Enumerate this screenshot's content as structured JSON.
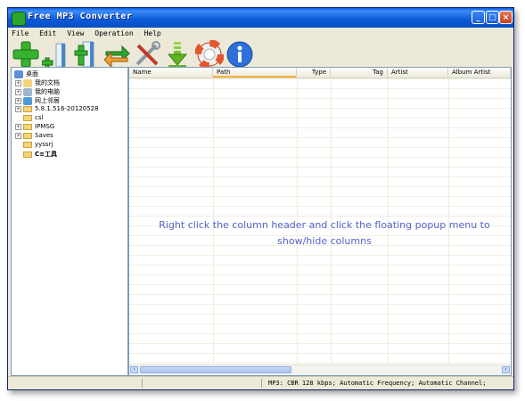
{
  "window": {
    "title": "Free MP3 Converter",
    "controls": {
      "minimize": "_",
      "maximize": "□",
      "close": "×"
    }
  },
  "menu": [
    "File",
    "Edit",
    "View",
    "Operation",
    "Help"
  ],
  "toolbar": {
    "buttons": [
      {
        "name": "add-files-icon",
        "color": "#2ea52b"
      },
      {
        "name": "add-folder-icon",
        "color": "#2ea52b"
      },
      {
        "name": "remove-file-icon",
        "color": "#2ea52b"
      },
      {
        "name": "convert-icon",
        "color": "#2e9d2e"
      },
      {
        "name": "tools-icon",
        "color": "#6f7f8f"
      },
      {
        "name": "download-icon",
        "color": "#8ad13b"
      },
      {
        "name": "help-lifebuoy-icon",
        "color": "#e4572e"
      },
      {
        "name": "about-info-icon",
        "color": "#2f6fd8"
      }
    ]
  },
  "tree": {
    "items": [
      {
        "label": "桌面",
        "expander": "",
        "icon": "desktop-icon"
      },
      {
        "label": "我的文档",
        "expander": "+",
        "icon": "documents-icon"
      },
      {
        "label": "我的电脑",
        "expander": "+",
        "icon": "computer-icon"
      },
      {
        "label": "网上邻居",
        "expander": "+",
        "icon": "network-icon"
      },
      {
        "label": "5.8.1.516-20120528",
        "expander": "+",
        "icon": "folder-icon"
      },
      {
        "label": "csl",
        "expander": "",
        "icon": "folder-icon"
      },
      {
        "label": "IPMSG",
        "expander": "+",
        "icon": "folder-icon"
      },
      {
        "label": "Saves",
        "expander": "+",
        "icon": "folder-icon"
      },
      {
        "label": "yyssrj",
        "expander": "",
        "icon": "folder-icon"
      },
      {
        "label": "C≡工具",
        "expander": "",
        "icon": "folder-icon"
      }
    ]
  },
  "list": {
    "columns": [
      "Name",
      "Path",
      "Type",
      "Tag",
      "Artist",
      "Album Artist"
    ],
    "active_column": "Path",
    "hint": "Right click the column header and click the floating popup menu to show/hide columns"
  },
  "status": {
    "text": "MP3:   CBR 128 kbps; Automatic Frequency; Automatic Channel;"
  }
}
